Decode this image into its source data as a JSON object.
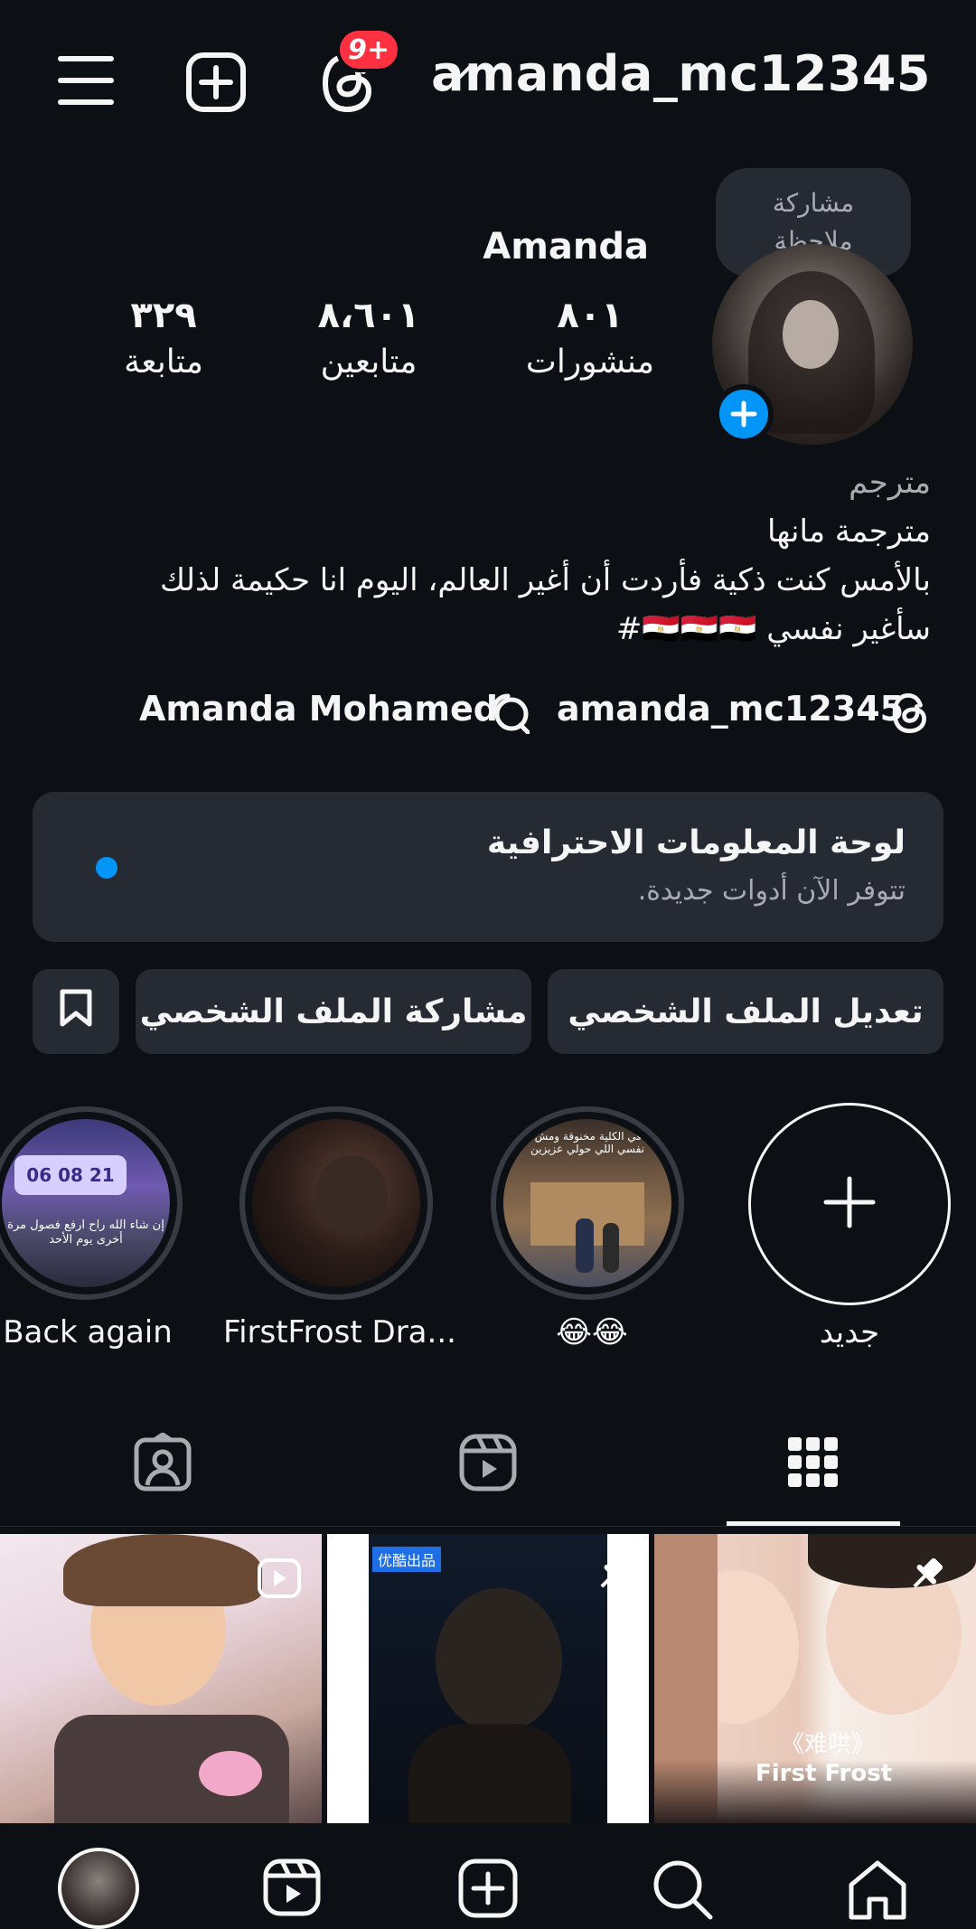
{
  "header": {
    "username": "amanda_mc12345",
    "notification_badge": "9+"
  },
  "note": {
    "text_line1": "مشاركة",
    "text_line2": "ملاحظة"
  },
  "profile": {
    "display_name": "Amanda",
    "stats": [
      {
        "value": "٨٠١",
        "label": "منشورات"
      },
      {
        "value": "٨،٦٠١",
        "label": "متابعين"
      },
      {
        "value": "٣٢٩",
        "label": "متابعة"
      }
    ],
    "bio": {
      "category": "مترجم",
      "line1": "مترجمة مانها",
      "line2": "بالأمس كنت ذكية فأردت أن أغير العالم، اليوم انا حكيمة لذلك",
      "line3": "سأغير نفسي 🇪🇬🇪🇬🇪🇬#"
    },
    "links": {
      "threads": "amanda_mc12345",
      "facebook": "Amanda Mohamed"
    }
  },
  "dashboard": {
    "title": "لوحة المعلومات الاحترافية",
    "subtitle": "تتوفر الآن أدوات جديدة."
  },
  "buttons": {
    "edit_profile": "تعديل الملف الشخصي",
    "share_profile": "مشاركة الملف الشخصي"
  },
  "highlights": [
    {
      "label": "جديد"
    },
    {
      "label": "😂😂"
    },
    {
      "label": "FirstFrost Dra..."
    },
    {
      "label": "Back again"
    }
  ],
  "highlight_texts": {
    "campus_caption": "واقفة في الكلية مخنوقة ومش طايقة نفسي اللي حولي عزيزين",
    "timer_caption": "إن شاء الله راح ارفع فصول مرة أخرى يوم الأحد",
    "timer_digits": "06 08 21"
  },
  "grid_texts": {
    "cell2_badge": "优酷出品",
    "cell3_title_cn": "《难哄》",
    "cell3_title_en": "First Frost"
  },
  "colors": {
    "accent": "#0095f6",
    "badge": "#ff3040",
    "bg": "#0c1014",
    "surface": "#262a33"
  }
}
